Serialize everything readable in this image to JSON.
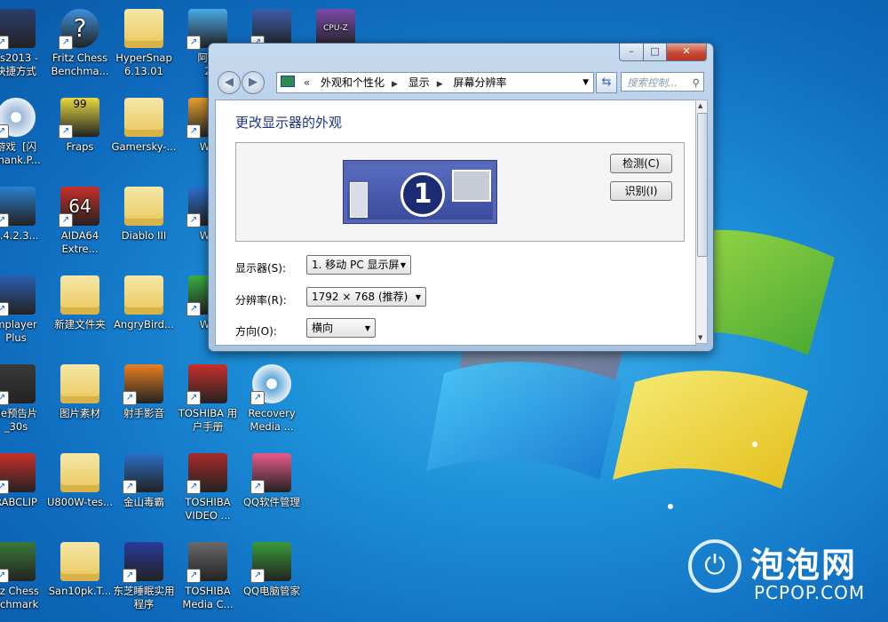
{
  "desktop_icons": [
    {
      "label": "es2013 -\n快捷方式",
      "kind": "game",
      "color": "#2b3e6e"
    },
    {
      "label": "Fritz Chess\nBenchma...",
      "kind": "help",
      "color": "#3f8fdc"
    },
    {
      "label": "HyperSnap\n6.13.01",
      "kind": "folder",
      "color": "#e8c86a"
    },
    {
      "label": "阿里\n2",
      "kind": "app",
      "color": "#4aa8e8"
    },
    {
      "label": "",
      "kind": "app",
      "color": "#3b5da8"
    },
    {
      "label": "",
      "kind": "cpuz",
      "color": "#7a4aa8"
    },
    {
      "label": "游戏  [闪\nShank.P...",
      "kind": "disc",
      "color": "#9ab8d8"
    },
    {
      "label": "Fraps",
      "kind": "fraps",
      "color": "#e8d840"
    },
    {
      "label": "Gamersky-...",
      "kind": "folder",
      "color": "#e8c86a"
    },
    {
      "label": "WP",
      "kind": "app",
      "color": "#e8a030"
    },
    {
      "label": "3.4.2.3...",
      "kind": "app",
      "color": "#2a7fd0"
    },
    {
      "label": "AIDA64\nExtre...",
      "kind": "aida",
      "color": "#c8302a"
    },
    {
      "label": "Diablo III",
      "kind": "folder",
      "color": "#e8c86a"
    },
    {
      "label": "WP",
      "kind": "app",
      "color": "#2a6fd0"
    },
    {
      "label": "mplayer\nPlus",
      "kind": "app",
      "color": "#2a5fb0"
    },
    {
      "label": "新建文件夹",
      "kind": "folder",
      "color": "#e8c86a"
    },
    {
      "label": "AngryBird...",
      "kind": "folder",
      "color": "#e8c86a"
    },
    {
      "label": "WP",
      "kind": "app",
      "color": "#3ab040"
    },
    {
      "label": "de预告片\n_30s",
      "kind": "video",
      "color": "#3a3a3a"
    },
    {
      "label": "图片素材",
      "kind": "folder",
      "color": "#e8c86a"
    },
    {
      "label": "射手影音",
      "kind": "app",
      "color": "#e88020"
    },
    {
      "label": "TOSHIBA 用\n户手册",
      "kind": "app",
      "color": "#c8302a"
    },
    {
      "label": "Recovery\nMedia ...",
      "kind": "disc",
      "color": "#60a8d8"
    },
    {
      "label": "RABCLIP",
      "kind": "app",
      "color": "#c8302a"
    },
    {
      "label": "U800W-tes...",
      "kind": "folder",
      "color": "#e8c86a"
    },
    {
      "label": "金山毒霸",
      "kind": "app",
      "color": "#2a70c8"
    },
    {
      "label": "TOSHIBA\nVIDEO ...",
      "kind": "app",
      "color": "#a82a2a"
    },
    {
      "label": "QQ软件管理",
      "kind": "app",
      "color": "#e85a8a"
    },
    {
      "label": "itz Chess\nnchmark",
      "kind": "app",
      "color": "#3a7a3a"
    },
    {
      "label": "San10pk.T...",
      "kind": "folder",
      "color": "#e8c86a"
    },
    {
      "label": "东芝睡眠实用\n程序",
      "kind": "app",
      "color": "#2a3a9a"
    },
    {
      "label": "TOSHIBA\nMedia C...",
      "kind": "app",
      "color": "#6a6a6a"
    },
    {
      "label": "QQ电脑管家",
      "kind": "app",
      "color": "#3a9a3a"
    }
  ],
  "window": {
    "breadcrumbs": [
      "外观和个性化",
      "显示",
      "屏幕分辨率"
    ],
    "back_prefix": "«",
    "search_placeholder": "搜索控制...",
    "heading": "更改显示器的外观",
    "monitor_number": "1",
    "detect_button": "检测(C)",
    "identify_button": "识别(I)",
    "display_label": "显示器(S):",
    "display_value": "1. 移动 PC 显示屏",
    "resolution_label": "分辨率(R):",
    "resolution_value": "1792 × 768 (推荐)",
    "orientation_label": "方向(O):",
    "orientation_value": "横向"
  },
  "watermark": {
    "cn": "泡泡网",
    "en": "PCPOP.COM"
  }
}
